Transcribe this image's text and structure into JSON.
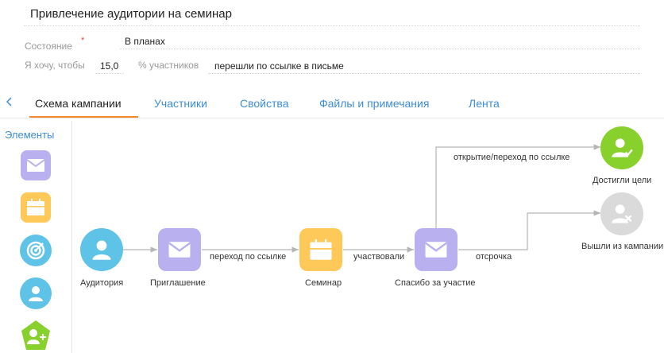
{
  "header": {
    "title": "Привлечение аудитории на семинар"
  },
  "form": {
    "state_label": "Состояние",
    "state_required": "*",
    "state_value": "В планах",
    "goal_prefix": "Я хочу, чтобы",
    "goal_value": "15,0",
    "goal_unit": "% участников",
    "goal_action": "перешли по ссылке в письме"
  },
  "tabs": {
    "back": "<",
    "items": [
      "Схема кампании",
      "Участники",
      "Свойства",
      "Файлы и примечания",
      "Лента"
    ],
    "active": "Схема кампании"
  },
  "palette": {
    "title": "Элементы",
    "items": [
      {
        "name": "email",
        "color": "#b9b1ef"
      },
      {
        "name": "event",
        "color": "#ffc95a"
      },
      {
        "name": "target",
        "color": "#5fc3e8"
      },
      {
        "name": "audience",
        "color": "#5fc3e8"
      },
      {
        "name": "add-contact",
        "color": "#88d12d"
      }
    ]
  },
  "flow": {
    "nodes": [
      {
        "label": "Аудитория"
      },
      {
        "label": "Приглашение"
      },
      {
        "label": "Семинар"
      },
      {
        "label": "Спасибо за участие"
      },
      {
        "label": "Достигли цели"
      },
      {
        "label": "Вышли из кампании"
      }
    ],
    "connections": [
      {
        "label": "переход по ссылке"
      },
      {
        "label": "участвовали"
      },
      {
        "label": "отсрочка"
      },
      {
        "label": "открытие/переход по ссылке"
      }
    ]
  },
  "colors": {
    "accent": "#f28a2f",
    "link": "#3c8dd6",
    "email": "#b9b1ef",
    "event": "#ffc95a",
    "audience": "#5fc3e8",
    "goal": "#88d12d",
    "exit": "#dadada"
  }
}
